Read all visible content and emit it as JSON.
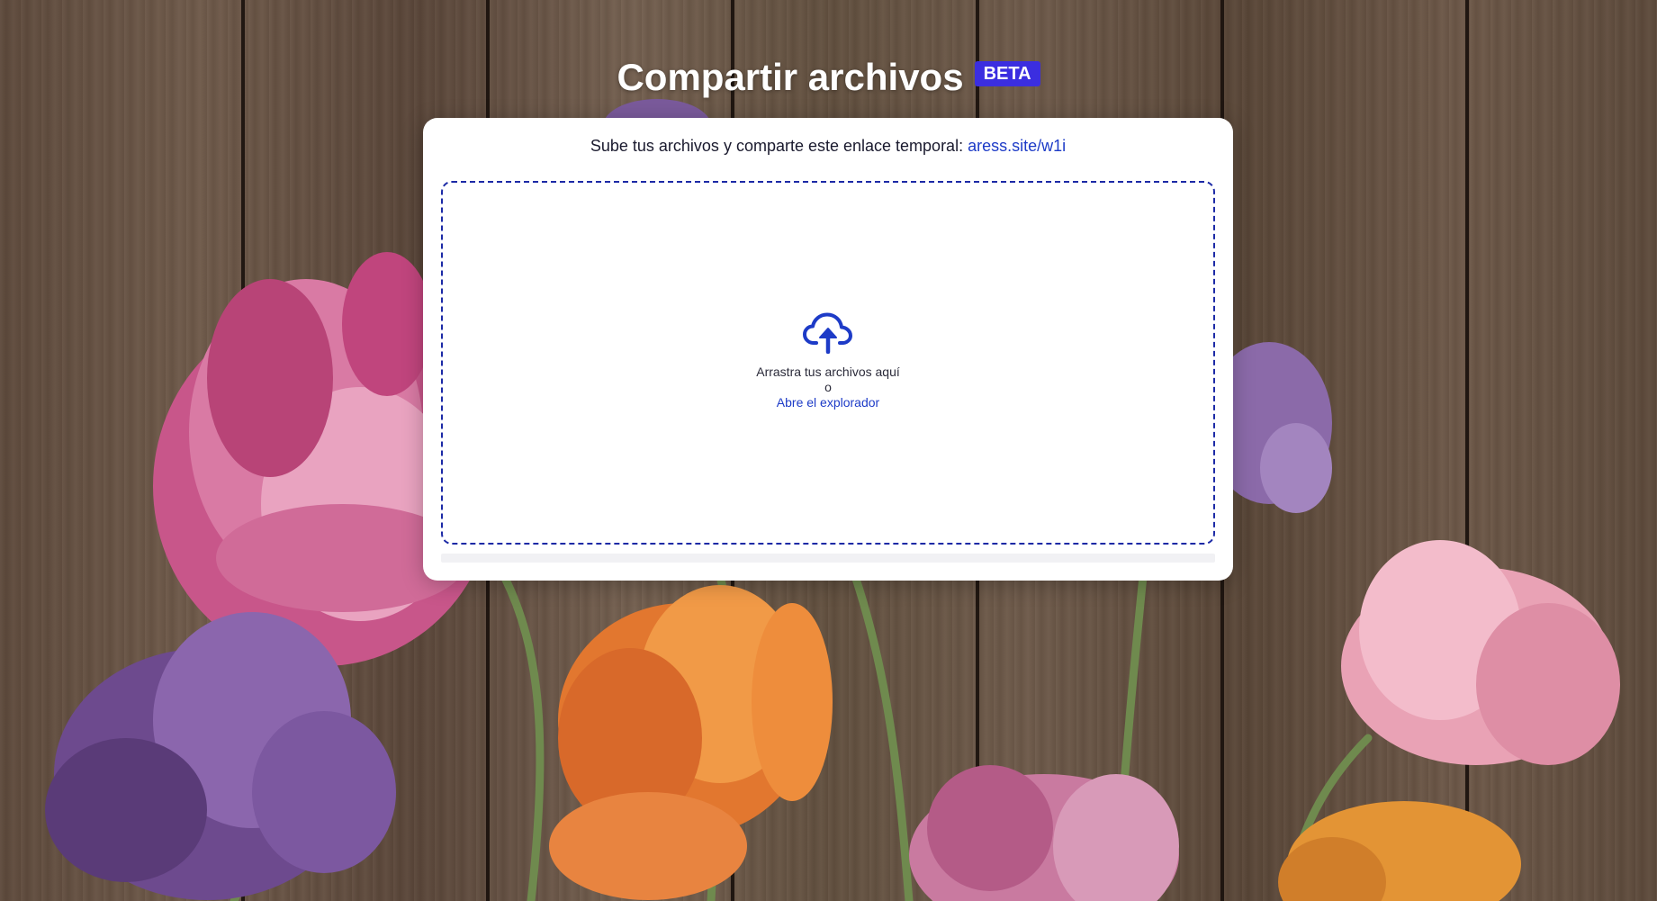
{
  "header": {
    "title": "Compartir archivos",
    "badge": "BETA"
  },
  "card": {
    "subtitle": "Sube tus archivos y comparte este enlace temporal:",
    "share_link": "aress.site/w1i"
  },
  "dropzone": {
    "icon": "cloud-upload-icon",
    "drag_text": "Arrastra tus archivos aquí",
    "or_text": "o",
    "browse_label": "Abre el explorador"
  },
  "colors": {
    "accent": "#1d3bc7",
    "badge": "#3b2ee0",
    "dropzone_border": "#1c2aa6"
  }
}
